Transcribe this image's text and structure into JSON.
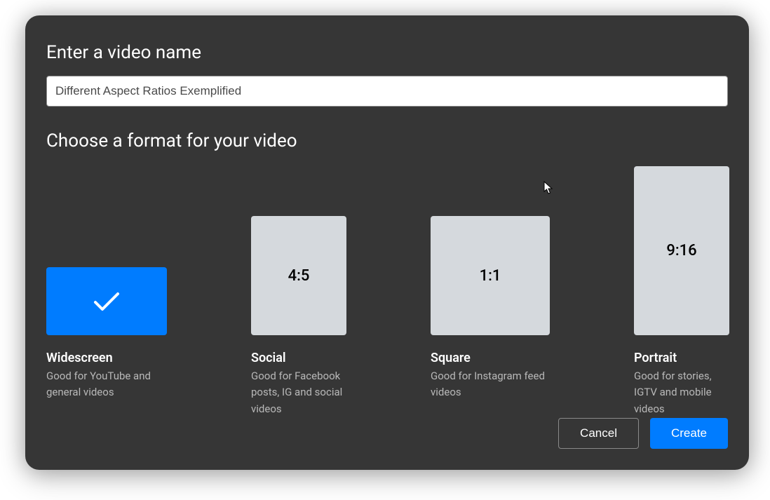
{
  "headings": {
    "name": "Enter a video name",
    "format": "Choose a format for your video"
  },
  "input": {
    "value": "Different Aspect Ratios Exemplified",
    "placeholder": ""
  },
  "formats": {
    "widescreen": {
      "ratio": "",
      "title": "Widescreen",
      "desc": "Good for YouTube and general videos",
      "selected": true
    },
    "social": {
      "ratio": "4:5",
      "title": "Social",
      "desc": "Good for Facebook posts, IG and social videos",
      "selected": false
    },
    "square": {
      "ratio": "1:1",
      "title": "Square",
      "desc": "Good for Instagram feed videos",
      "selected": false
    },
    "portrait": {
      "ratio": "9:16",
      "title": "Portrait",
      "desc": "Good for stories, IGTV and mobile videos",
      "selected": false
    }
  },
  "buttons": {
    "cancel": "Cancel",
    "create": "Create"
  }
}
